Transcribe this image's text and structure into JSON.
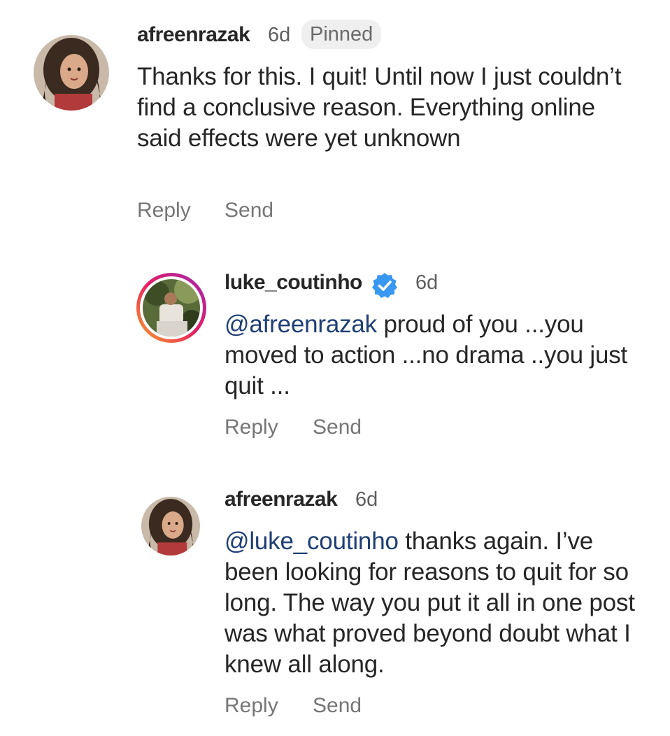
{
  "comments": [
    {
      "username": "afreenrazak",
      "time": "6d",
      "badge": "Pinned",
      "mention": "",
      "text": "Thanks for this. I quit! Until now I just couldn’t find a conclusive reason. Everything online said effects were yet unknown",
      "reply_label": "Reply",
      "send_label": "Send"
    },
    {
      "username": "luke_coutinho",
      "verified": true,
      "time": "6d",
      "mention": "@afreenrazak",
      "text": " proud of you ...you moved to action ...no drama ..you just quit ...",
      "reply_label": "Reply",
      "send_label": "Send"
    },
    {
      "username": "afreenrazak",
      "time": "6d",
      "mention": "@luke_coutinho",
      "text": " thanks again. I’ve been looking for reasons to quit for so long. The way you put it all in one post was what proved beyond doubt what I knew all along.",
      "reply_label": "Reply",
      "send_label": "Send"
    }
  ],
  "colors": {
    "mention": "#1f3f74",
    "verified": "#3897f0",
    "story_ring_start": "#f9a825",
    "story_ring_end": "#c2185b"
  }
}
